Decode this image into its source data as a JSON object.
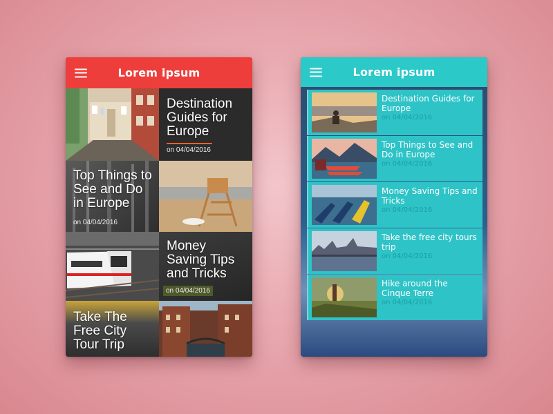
{
  "left_app": {
    "title": "Lorem ipsum",
    "accent": "#ee3e3b",
    "cells": [
      {
        "title": "Destination Guides for Europe",
        "date": "on 04/04/2016"
      },
      {
        "title": "Top Things to See and Do in Europe",
        "date": "on 04/04/2016"
      },
      {
        "title": "Money Saving Tips and Tricks",
        "date": "on 04/04/2016"
      },
      {
        "title": "Take The Free City Tour Trip",
        "date": ""
      }
    ]
  },
  "right_app": {
    "title": "Lorem ipsum",
    "accent": "#2cc9c9",
    "items": [
      {
        "title": "Destination Guides for Europe",
        "date": "on 04/04/2016"
      },
      {
        "title": "Top Things to See and Do in Europe",
        "date": "on 04/04/2016"
      },
      {
        "title": "Money Saving Tips and Tricks",
        "date": "on 04/04/2016"
      },
      {
        "title": "Take the free city tours trip",
        "date": "on 04/04/2016"
      },
      {
        "title": "Hike around the Cinque Terre",
        "date": "on 04/04/2016"
      }
    ]
  },
  "icons": {
    "menu": "hamburger-menu-icon"
  }
}
